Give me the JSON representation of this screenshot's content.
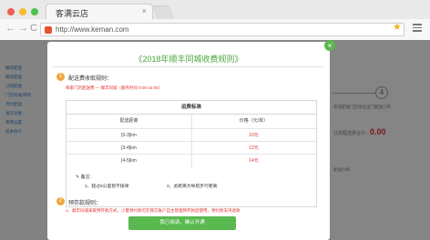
{
  "browser": {
    "tab_title": "客满云店",
    "tab_close": "×",
    "url": "http://www.keman.com",
    "back": "←",
    "forward": "→",
    "reload": "C",
    "star": "★"
  },
  "page": {
    "sidebar_items": [
      "桶装配送",
      "桶装配送",
      "订购配送",
      "门店同城/转单",
      "月付配送",
      "送货对账",
      "费用设置",
      "成本统计"
    ],
    "step_number": "4",
    "step_text": "完成配送门店单位出门配送订单",
    "total_label": "订单配送费合计：",
    "total_value": "0.00",
    "row_text": "配送价格"
  },
  "modal": {
    "close": "×",
    "title": "《2018年顺丰同城收费规则》",
    "section1_number": "1",
    "section1_title": "配送费收取规则：",
    "section1_note": "每家门店配送费 — 顺丰同城（服务时间 9:00-22:00）",
    "table_title": "运费标准",
    "col_distance": "配送距离",
    "col_price": "价格（元/单）",
    "rows": [
      {
        "distance": "[0-3]km",
        "price": "10元"
      },
      {
        "distance": "[3-4]km",
        "price": "12元"
      },
      {
        "distance": "[4-5]km",
        "price": "14元"
      }
    ],
    "remark_label": "✎ 备注：",
    "remark_items": [
      "1、超过5公里暂不接单",
      "2、此距离为导航步行距离"
    ],
    "section2_number": "2",
    "section2_title": "预存款规则：",
    "section2_note": "1、顺丰同城采取预存款方式，少量预付款可在我方账户自主管理预存款后使用，预付款支持退款",
    "confirm_label": "我已阅读，确认开通"
  },
  "colors": {
    "accent_green": "#59b84e",
    "accent_orange": "#f0a63c",
    "price_red": "#e03131"
  }
}
